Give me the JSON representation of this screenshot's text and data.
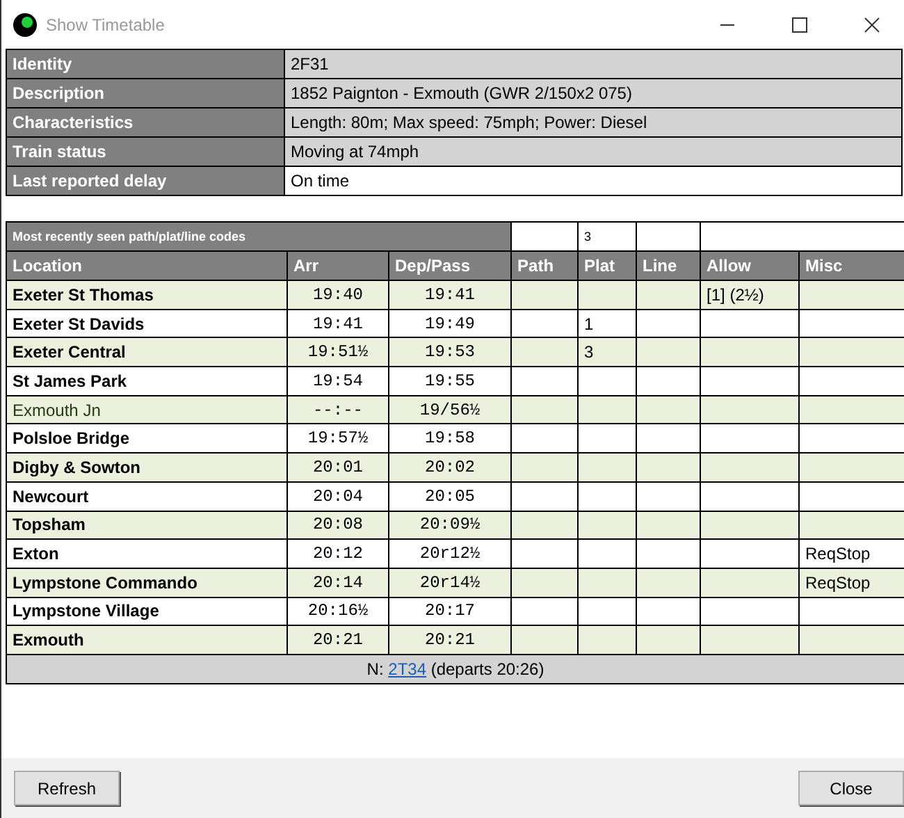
{
  "window": {
    "title": "Show Timetable"
  },
  "info": [
    {
      "label": "Identity",
      "value": "2F31",
      "shaded": true
    },
    {
      "label": "Description",
      "value": "1852 Paignton - Exmouth (GWR 2/150x2 075)",
      "shaded": true
    },
    {
      "label": "Characteristics",
      "value": "Length: 80m; Max speed: 75mph; Power: Diesel",
      "shaded": true
    },
    {
      "label": "Train status",
      "value": "Moving at 74mph",
      "shaded": true
    },
    {
      "label": "Last reported delay",
      "value": "On time",
      "shaded": false
    }
  ],
  "codes": {
    "label": "Most recently seen path/plat/line codes",
    "plat": "3"
  },
  "columns": [
    "Location",
    "Arr",
    "Dep/Pass",
    "Path",
    "Plat",
    "Line",
    "Allow",
    "Misc"
  ],
  "rows": [
    {
      "location": "Exeter St Thomas",
      "stop": true,
      "arr": "19:40",
      "dep": "19:41",
      "allow": "[1] (2½)"
    },
    {
      "location": "Exeter St Davids",
      "stop": true,
      "arr": "19:41",
      "dep": "19:49",
      "plat": "1"
    },
    {
      "location": "Exeter Central",
      "stop": true,
      "arr": "19:51½",
      "dep": "19:53",
      "plat": "3"
    },
    {
      "location": "St James Park",
      "stop": true,
      "arr": "19:54",
      "dep": "19:55"
    },
    {
      "location": "Exmouth Jn",
      "stop": false,
      "arr": "--:--",
      "dep": "19/56½"
    },
    {
      "location": "Polsloe Bridge",
      "stop": true,
      "arr": "19:57½",
      "dep": "19:58"
    },
    {
      "location": "Digby & Sowton",
      "stop": true,
      "arr": "20:01",
      "dep": "20:02"
    },
    {
      "location": "Newcourt",
      "stop": true,
      "arr": "20:04",
      "dep": "20:05"
    },
    {
      "location": "Topsham",
      "stop": true,
      "arr": "20:08",
      "dep": "20:09½"
    },
    {
      "location": "Exton",
      "stop": true,
      "arr": "20:12",
      "dep": "20r12½",
      "misc": "ReqStop"
    },
    {
      "location": "Lympstone Commando",
      "stop": true,
      "arr": "20:14",
      "dep": "20r14½",
      "misc": "ReqStop"
    },
    {
      "location": "Lympstone Village",
      "stop": true,
      "arr": "20:16½",
      "dep": "20:17"
    },
    {
      "location": "Exmouth",
      "stop": true,
      "arr": "20:21",
      "dep": "20:21"
    }
  ],
  "next": {
    "prefix": "N: ",
    "link": "2T34",
    "suffix": " (departs 20:26)"
  },
  "buttons": [
    "Refresh",
    "Close"
  ]
}
